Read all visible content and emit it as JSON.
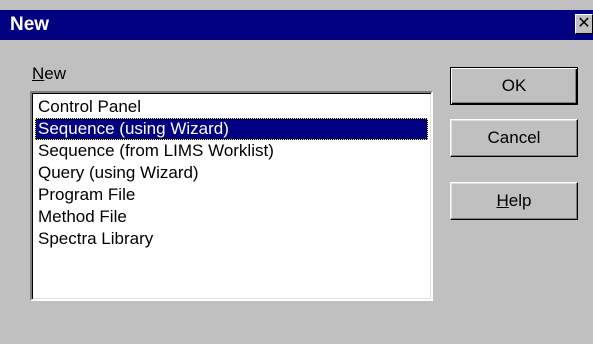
{
  "window": {
    "title": "New",
    "close_glyph": "✕"
  },
  "list": {
    "label_mnemonic": "N",
    "label_rest": "ew",
    "items": [
      {
        "label": "Control Panel",
        "selected": false
      },
      {
        "label": "Sequence (using Wizard)",
        "selected": true
      },
      {
        "label": "Sequence (from LIMS Worklist)",
        "selected": false
      },
      {
        "label": "Query (using Wizard)",
        "selected": false
      },
      {
        "label": "Program File",
        "selected": false
      },
      {
        "label": "Method File",
        "selected": false
      },
      {
        "label": "Spectra Library",
        "selected": false
      }
    ]
  },
  "buttons": {
    "ok_label": "OK",
    "cancel_label": "Cancel",
    "help_mnemonic": "H",
    "help_rest": "elp"
  },
  "colors": {
    "titlebar": "#000080",
    "selection": "#000080",
    "face": "#c0c0c0"
  }
}
